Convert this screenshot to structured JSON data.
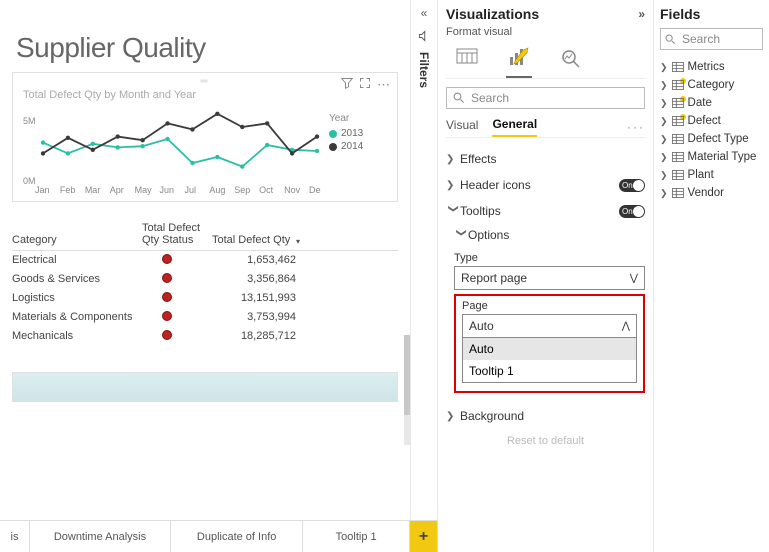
{
  "page_title": "Supplier Quality",
  "chart": {
    "title": "Total Defect Qty by Month and Year",
    "legend_header": "Year",
    "series": [
      {
        "name": "2013",
        "color": "#2bbfa6"
      },
      {
        "name": "2014",
        "color": "#3a3a3a"
      }
    ],
    "y_ticks": [
      "5M",
      "0M"
    ],
    "x_ticks": [
      "Jan",
      "Feb",
      "Mar",
      "Apr",
      "May",
      "Jun",
      "Jul",
      "Aug",
      "Sep",
      "Oct",
      "Nov",
      "Dec"
    ]
  },
  "chart_data": {
    "type": "line",
    "title": "Total Defect Qty by Month and Year",
    "xlabel": "",
    "ylabel": "",
    "categories": [
      "Jan",
      "Feb",
      "Mar",
      "Apr",
      "May",
      "Jun",
      "Jul",
      "Aug",
      "Sep",
      "Oct",
      "Nov",
      "Dec"
    ],
    "ylim": [
      0,
      6000000
    ],
    "series": [
      {
        "name": "2013",
        "color": "#2bbfa6",
        "values": [
          3200000,
          2300000,
          3100000,
          2800000,
          2900000,
          3500000,
          1500000,
          2000000,
          1200000,
          3000000,
          2600000,
          2500000
        ]
      },
      {
        "name": "2014",
        "color": "#3a3a3a",
        "values": [
          2300000,
          3600000,
          2600000,
          3700000,
          3400000,
          4800000,
          4300000,
          5600000,
          4500000,
          4800000,
          2300000,
          3700000
        ]
      }
    ]
  },
  "table": {
    "headers": {
      "c1": "Category",
      "c2": "Total Defect Qty Status",
      "c3": "Total Defect Qty"
    },
    "rows": [
      {
        "c1": "Electrical",
        "c3": "1,653,462"
      },
      {
        "c1": "Goods & Services",
        "c3": "3,356,864"
      },
      {
        "c1": "Logistics",
        "c3": "13,151,993"
      },
      {
        "c1": "Materials & Components",
        "c3": "3,753,994"
      },
      {
        "c1": "Mechanicals",
        "c3": "18,285,712"
      }
    ]
  },
  "page_tabs": [
    "is",
    "Downtime Analysis",
    "Duplicate of Info",
    "Tooltip 1"
  ],
  "filters_label": "Filters",
  "viz": {
    "title": "Visualizations",
    "subtitle": "Format visual",
    "search_placeholder": "Search",
    "tabs": {
      "visual": "Visual",
      "general": "General"
    },
    "sections": {
      "effects": "Effects",
      "header_icons": "Header icons",
      "tooltips": "Tooltips",
      "options": "Options",
      "background": "Background",
      "reset": "Reset to default"
    },
    "type_label": "Type",
    "type_value": "Report page",
    "page_label": "Page",
    "page_value": "Auto",
    "page_options": [
      "Auto",
      "Tooltip 1"
    ],
    "on_text": "On"
  },
  "fields": {
    "title": "Fields",
    "search_placeholder": "Search",
    "items": [
      {
        "name": "Metrics",
        "checked": true
      },
      {
        "name": "Category",
        "checked": true
      },
      {
        "name": "Date",
        "checked": true
      },
      {
        "name": "Defect",
        "checked": false
      },
      {
        "name": "Defect Type",
        "checked": false
      },
      {
        "name": "Material Type",
        "checked": false
      },
      {
        "name": "Plant",
        "checked": false
      },
      {
        "name": "Vendor",
        "checked": false
      }
    ]
  }
}
